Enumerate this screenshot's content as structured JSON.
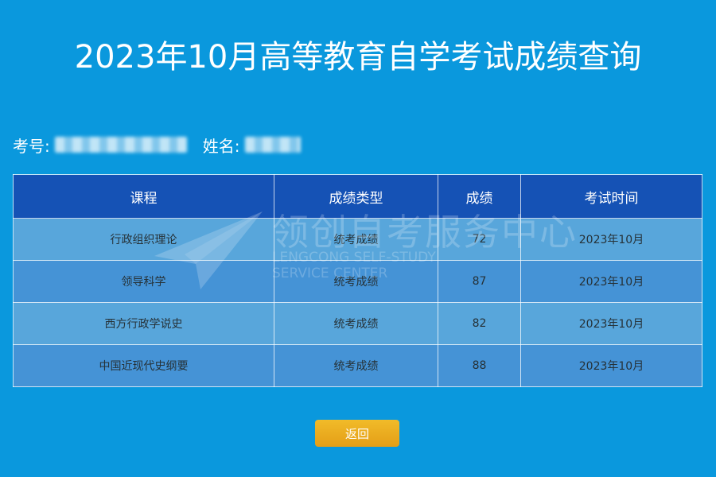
{
  "page": {
    "title": "2023年10月高等教育自学考试成绩查询"
  },
  "info": {
    "exam_no_label": "考号:",
    "name_label": "姓名:"
  },
  "table": {
    "headers": [
      "课程",
      "成绩类型",
      "成绩",
      "考试时间"
    ],
    "rows": [
      [
        "行政组织理论",
        "统考成绩",
        "72",
        "2023年10月"
      ],
      [
        "领导科学",
        "统考成绩",
        "87",
        "2023年10月"
      ],
      [
        "西方行政学说史",
        "统考成绩",
        "82",
        "2023年10月"
      ],
      [
        "中国近现代史纲要",
        "统考成绩",
        "88",
        "2023年10月"
      ]
    ]
  },
  "watermark": {
    "text": "领创自考服务中心",
    "sub_line1": "LENGCONG SELF-STUDY",
    "sub_line2": "SERVICE CENTER",
    "icon": "paper-plane-icon"
  },
  "actions": {
    "back_label": "返回"
  },
  "colors": {
    "background": "#0a98dd",
    "header_bg": "#1552b5",
    "row_light": "#58a6db",
    "row_dark": "#4593d6",
    "button": "#e9a81f"
  }
}
